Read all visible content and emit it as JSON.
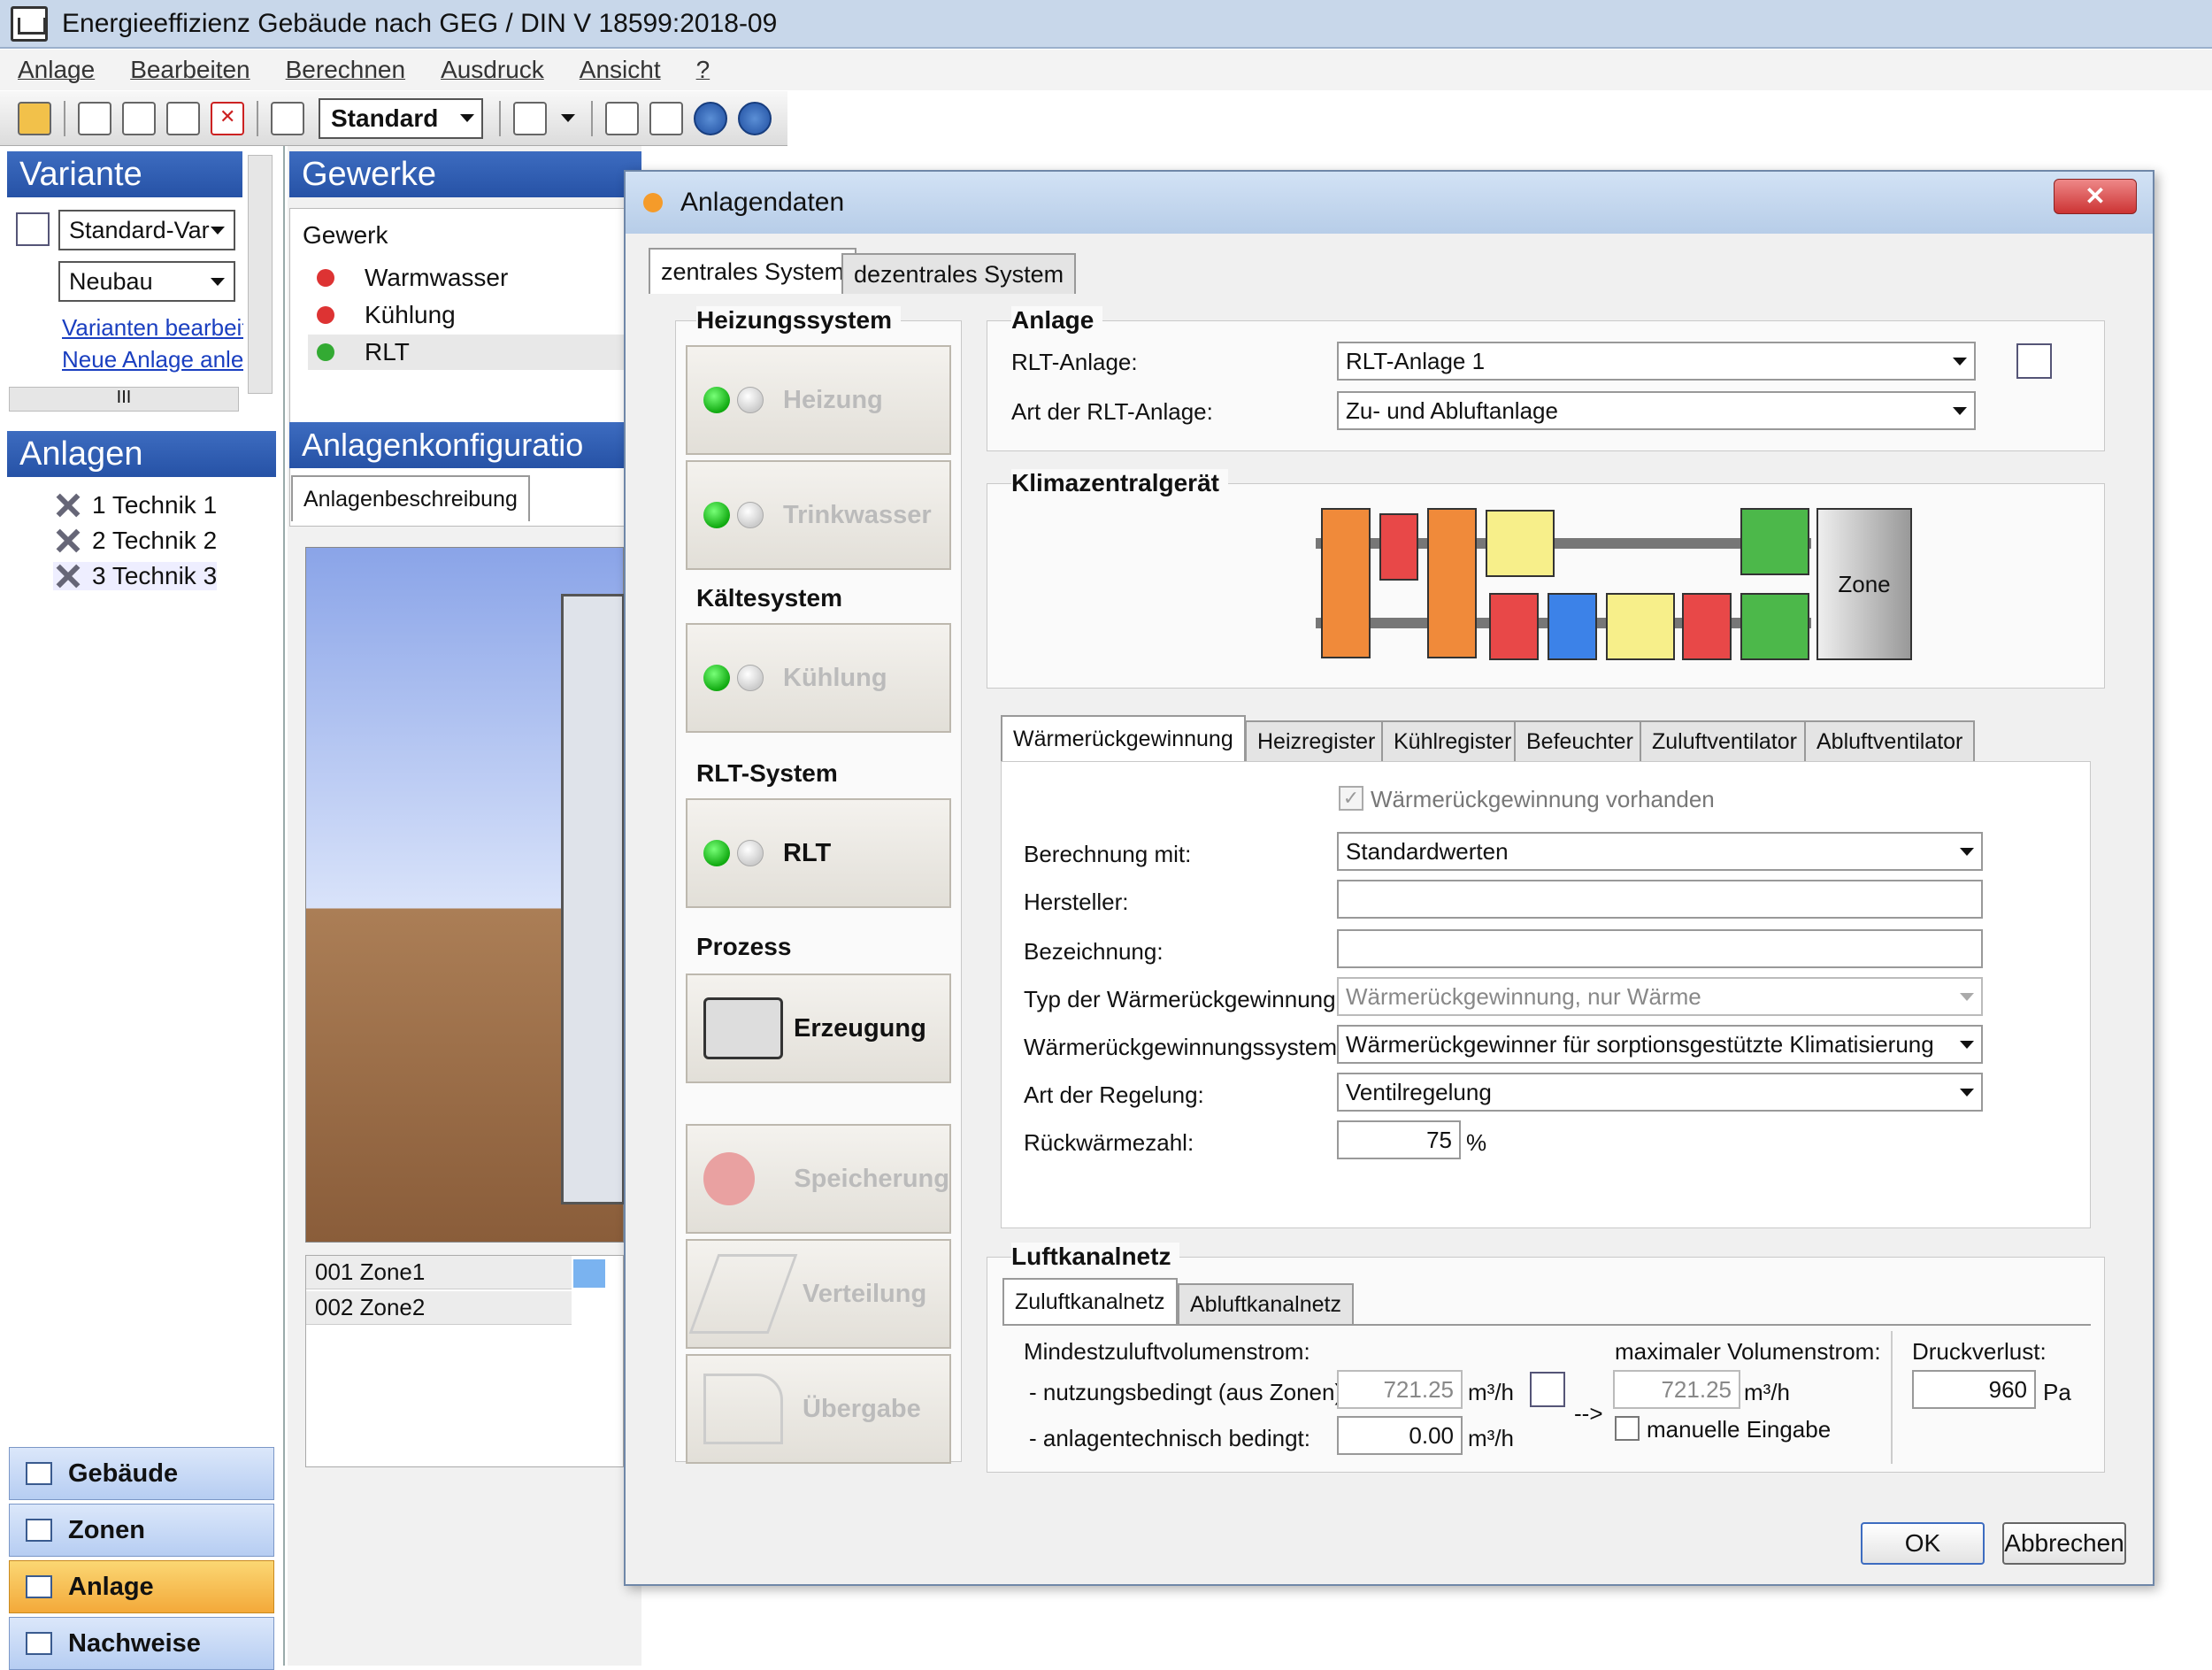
{
  "window": {
    "title": "Energieeffizienz Gebäude nach GEG / DIN V 18599:2018-09"
  },
  "menu": [
    "Anlage",
    "Bearbeiten",
    "Berechnen",
    "Ausdruck",
    "Ansicht",
    "?"
  ],
  "toolbar": {
    "profile": "Standard"
  },
  "left": {
    "variante_title": "Variante",
    "variante_select": "Standard-Var",
    "bau_select": "Neubau",
    "link1": "Varianten bearbeite",
    "link2": "Neue Anlage anlec",
    "scroll_mark": "III",
    "anlagen_title": "Anlagen",
    "tree": [
      "1 Technik 1",
      "2 Technik 2",
      "3 Technik 3"
    ],
    "nav": [
      "Gebäude",
      "Zonen",
      "Anlage",
      "Nachweise"
    ]
  },
  "middle": {
    "gewerke_title": "Gewerke",
    "gewerk_header": "Gewerk",
    "gewerke": [
      "Warmwasser",
      "Kühlung",
      "RLT"
    ],
    "config_title": "Anlagenkonfiguratio",
    "config_tab": "Anlagenbeschreibung",
    "zones": [
      "001 Zone1",
      "002 Zone2"
    ]
  },
  "dialog": {
    "title": "Anlagendaten",
    "close": "✕",
    "tabs": [
      "zentrales System",
      "dezentrales System"
    ],
    "groups": {
      "heizung": "Heizungssystem",
      "kaelte": "Kältesystem",
      "rlt": "RLT-System",
      "prozess": "Prozess"
    },
    "buttons": {
      "heizung": "Heizung",
      "trinkwasser": "Trinkwasser",
      "kuehlung": "Kühlung",
      "rlt": "RLT",
      "erzeugung": "Erzeugung",
      "speicherung": "Speicherung",
      "verteilung": "Verteilung",
      "uebergabe": "Übergabe"
    },
    "anlage": {
      "title": "Anlage",
      "rlt_label": "RLT-Anlage:",
      "rlt_value": "RLT-Anlage 1",
      "art_label": "Art der RLT-Anlage:",
      "art_value": "Zu- und Abluftanlage"
    },
    "klima": {
      "title": "Klimazentralgerät",
      "zone": "Zone"
    },
    "subtabs": [
      "Wärmerückgewinnung",
      "Heizregister",
      "Kühlregister",
      "Befeuchter",
      "Zuluftventilator",
      "Abluftventilator"
    ],
    "wrg": {
      "checkbox": "Wärmerückgewinnung vorhanden",
      "berechnung_label": "Berechnung mit:",
      "berechnung_value": "Standardwerten",
      "hersteller_label": "Hersteller:",
      "hersteller_value": "",
      "bezeichnung_label": "Bezeichnung:",
      "bezeichnung_value": "",
      "typ_label": "Typ der Wärmerückgewinnung:",
      "typ_value": "Wärmerückgewinnung, nur Wärme",
      "system_label": "Wärmerückgewinnungssystem:",
      "system_value": "Wärmerückgewinner für sorptionsgestützte Klimatisierung",
      "regelung_label": "Art der Regelung:",
      "regelung_value": "Ventilregelung",
      "rueck_label": "Rückwärmezahl:",
      "rueck_value": "75",
      "rueck_unit": "%"
    },
    "luft": {
      "title": "Luftkanalnetz",
      "tabs": [
        "Zuluftkanalnetz",
        "Abluftkanalnetz"
      ],
      "min_label": "Mindestzuluftvolumenstrom:",
      "nutz_label": "- nutzungsbedingt (aus Zonen):",
      "nutz_value": "721.25",
      "anlage_label": "- anlagentechnisch bedingt:",
      "anlage_value": "0.00",
      "unit": "m³/h",
      "arrow": "-->",
      "max_label": "maximaler Volumenstrom:",
      "max_value": "721.25",
      "manuell": "manuelle Eingabe",
      "druck_label": "Druckverlust:",
      "druck_value": "960",
      "druck_unit": "Pa"
    },
    "ok": "OK",
    "cancel": "Abbrechen"
  }
}
